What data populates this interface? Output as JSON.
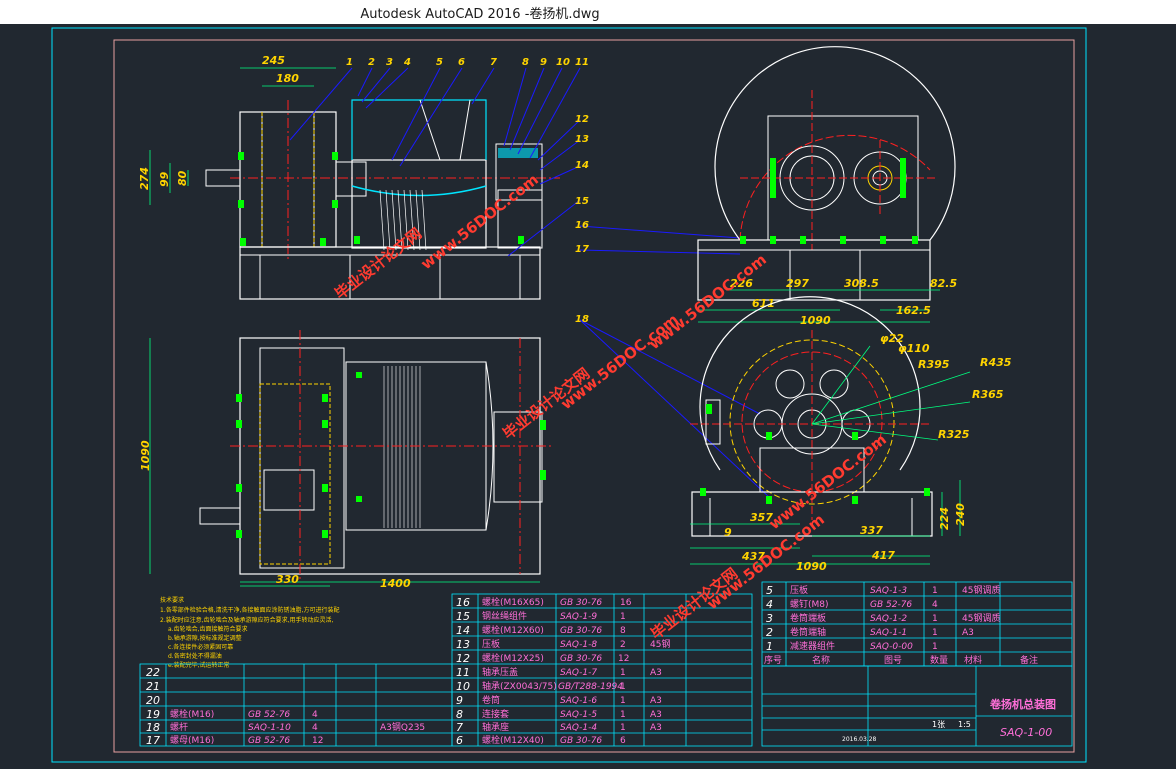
{
  "window": {
    "title": "Autodesk AutoCAD 2016    -卷扬机.dwg"
  },
  "part_balloons": [
    "1",
    "2",
    "3",
    "4",
    "5",
    "6",
    "7",
    "8",
    "9",
    "10",
    "11",
    "12",
    "13",
    "14",
    "15",
    "16",
    "17",
    "18"
  ],
  "dimensions": {
    "top_view": [
      "245",
      "180",
      "274",
      "99",
      "80"
    ],
    "plan_view": [
      "1090",
      "330",
      "1400"
    ],
    "side_view_top": [
      "226",
      "297",
      "308.5",
      "82.5",
      "611",
      "1090",
      "162.5"
    ],
    "side_view_bottom": [
      "φ22",
      "φ110",
      "R395",
      "R435",
      "R365",
      "R325",
      "357",
      "9",
      "337",
      "437",
      "417",
      "224",
      "240",
      "1090"
    ]
  },
  "watermark": {
    "text_cn": "毕业设计论文网",
    "text_url": "www.56DOC.com"
  },
  "tech_notes": [
    "技术要求",
    "1.各零部件检验合格,清洗干净,各接触面应涂防锈油脂,方可进行装配",
    "2.装配时应注意,齿轮啮合及轴承游隙应符合要求,用手转动应灵活,",
    "a.齿轮啮合,齿面接触符合要求",
    "b.轴承游隙,按标准规定调整",
    "c.各连接件必须紧固可靠",
    "d.各密封处不得漏油",
    "e.装配完毕,试运转正常"
  ],
  "bom_left": [
    {
      "no": "22",
      "name": "",
      "code": "",
      "qty": "",
      "mat": "",
      "note": ""
    },
    {
      "no": "21",
      "name": "",
      "code": "",
      "qty": "",
      "mat": "",
      "note": ""
    },
    {
      "no": "20",
      "name": "",
      "code": "",
      "qty": "",
      "mat": "",
      "note": ""
    },
    {
      "no": "19",
      "name": "螺栓(M16)",
      "code": "GB 52-76",
      "qty": "4",
      "mat": "",
      "note": ""
    },
    {
      "no": "18",
      "name": "螺杆",
      "code": "SAQ-1-10",
      "qty": "4",
      "mat": "",
      "note": "A3钢Q235"
    },
    {
      "no": "17",
      "name": "螺母(M16)",
      "code": "GB 52-76",
      "qty": "12",
      "mat": "",
      "note": ""
    }
  ],
  "bom_mid": [
    {
      "no": "16",
      "name": "螺栓(M16X65)",
      "code": "GB 30-76",
      "qty": "16",
      "mat": ""
    },
    {
      "no": "15",
      "name": "钢丝绳组件",
      "code": "SAQ-1-9",
      "qty": "1",
      "mat": ""
    },
    {
      "no": "14",
      "name": "螺栓(M12X60)",
      "code": "GB 30-76",
      "qty": "8",
      "mat": ""
    },
    {
      "no": "13",
      "name": "压板",
      "code": "SAQ-1-8",
      "qty": "2",
      "mat": "45钢"
    },
    {
      "no": "12",
      "name": "螺栓(M12X25)",
      "code": "GB 30-76",
      "qty": "12",
      "mat": ""
    },
    {
      "no": "11",
      "name": "轴承压盖",
      "code": "SAQ-1-7",
      "qty": "1",
      "mat": "A3"
    },
    {
      "no": "10",
      "name": "轴承(ZX0043/75)",
      "code": "GB/T288-1994",
      "qty": "1",
      "mat": ""
    },
    {
      "no": "9",
      "name": "卷筒",
      "code": "SAQ-1-6",
      "qty": "1",
      "mat": "A3"
    },
    {
      "no": "8",
      "name": "连接套",
      "code": "SAQ-1-5",
      "qty": "1",
      "mat": "A3"
    },
    {
      "no": "7",
      "name": "轴承座",
      "code": "SAQ-1-4",
      "qty": "1",
      "mat": "A3"
    },
    {
      "no": "6",
      "name": "螺栓(M12X40)",
      "code": "GB 30-76",
      "qty": "6",
      "mat": ""
    }
  ],
  "bom_right": [
    {
      "no": "5",
      "name": "压板",
      "code": "SAQ-1-3",
      "qty": "1",
      "mat": "45钢调质"
    },
    {
      "no": "4",
      "name": "螺钉(M8)",
      "code": "GB 52-76",
      "qty": "4",
      "mat": ""
    },
    {
      "no": "3",
      "name": "卷筒端板",
      "code": "SAQ-1-2",
      "qty": "1",
      "mat": "45钢调质"
    },
    {
      "no": "2",
      "name": "卷筒端轴",
      "code": "SAQ-1-1",
      "qty": "1",
      "mat": "A3"
    },
    {
      "no": "1",
      "name": "减速器组件",
      "code": "SAQ-0-00",
      "qty": "1",
      "mat": ""
    }
  ],
  "bom_header": {
    "no": "序号",
    "name": "名称",
    "code": "图号",
    "qty": "数量",
    "mat": "材料",
    "note": "备注"
  },
  "title_block": {
    "title": "卷扬机总装图",
    "drawing_no": "SAQ-1-00",
    "scale": "1:5",
    "sheet": "1张",
    "date": "2016.03.28"
  },
  "colors": {
    "bg": "#212830",
    "frame": "#e8a0a0",
    "outline": "#ffffff",
    "hidden": "#ffd400",
    "center": "#ff2020",
    "dim": "#00ff7f",
    "leader": "#1a1aff",
    "cyan": "#00e5ff",
    "green": "#00ff00",
    "magenta": "#ff6fd8"
  }
}
